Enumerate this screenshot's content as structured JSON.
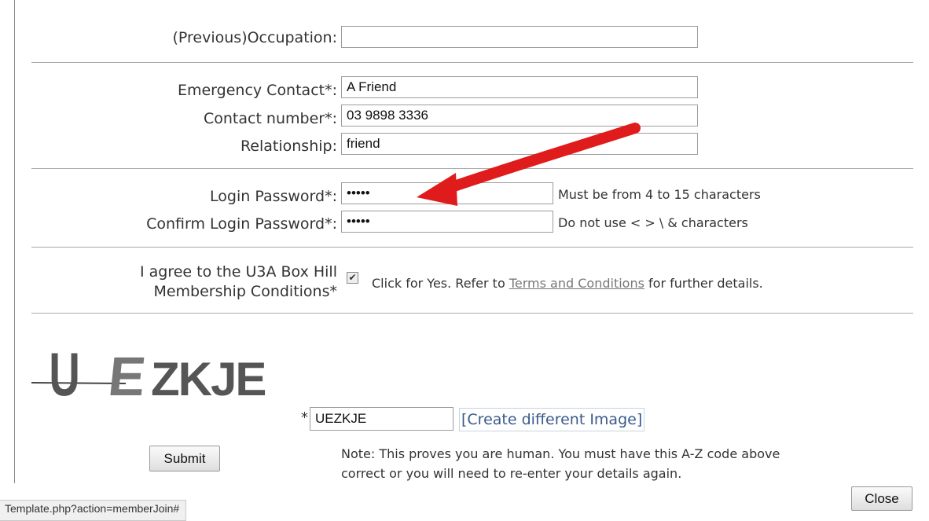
{
  "form": {
    "occupation": {
      "label": "(Previous)Occupation:",
      "value": ""
    },
    "emergency_contact": {
      "label": "Emergency Contact*:",
      "value": "A Friend"
    },
    "contact_number": {
      "label": "Contact number*:",
      "value": "03 9898 3336"
    },
    "relationship": {
      "label": "Relationship:",
      "value": "friend"
    },
    "login_password": {
      "label": "Login Password*:",
      "value": "•••••",
      "hint": "Must be from 4 to 15 characters"
    },
    "confirm_password": {
      "label": "Confirm Login Password*:",
      "value": "•••••",
      "hint": "Do not use < > \\ & characters"
    },
    "agree": {
      "label_line1": "I agree to the U3A Box Hill",
      "label_line2": "Membership Conditions*",
      "checked": true,
      "text_before": "Click for Yes. Refer to",
      "link_text": "Terms and Conditions",
      "text_after": "for further details."
    },
    "captcha": {
      "image_text": "UEZKJE",
      "asterisk": "*",
      "input_value": "UEZKJE",
      "create_link": "[Create different Image]",
      "note_line1": "Note: This proves you are human. You must have this A-Z code above",
      "note_line2": "correct or you will need to re-enter your details again."
    },
    "submit_label": "Submit"
  },
  "close_label": "Close",
  "status_url": "Template.php?action=memberJoin#",
  "annotation": {
    "arrow_color": "#e01b1b"
  }
}
